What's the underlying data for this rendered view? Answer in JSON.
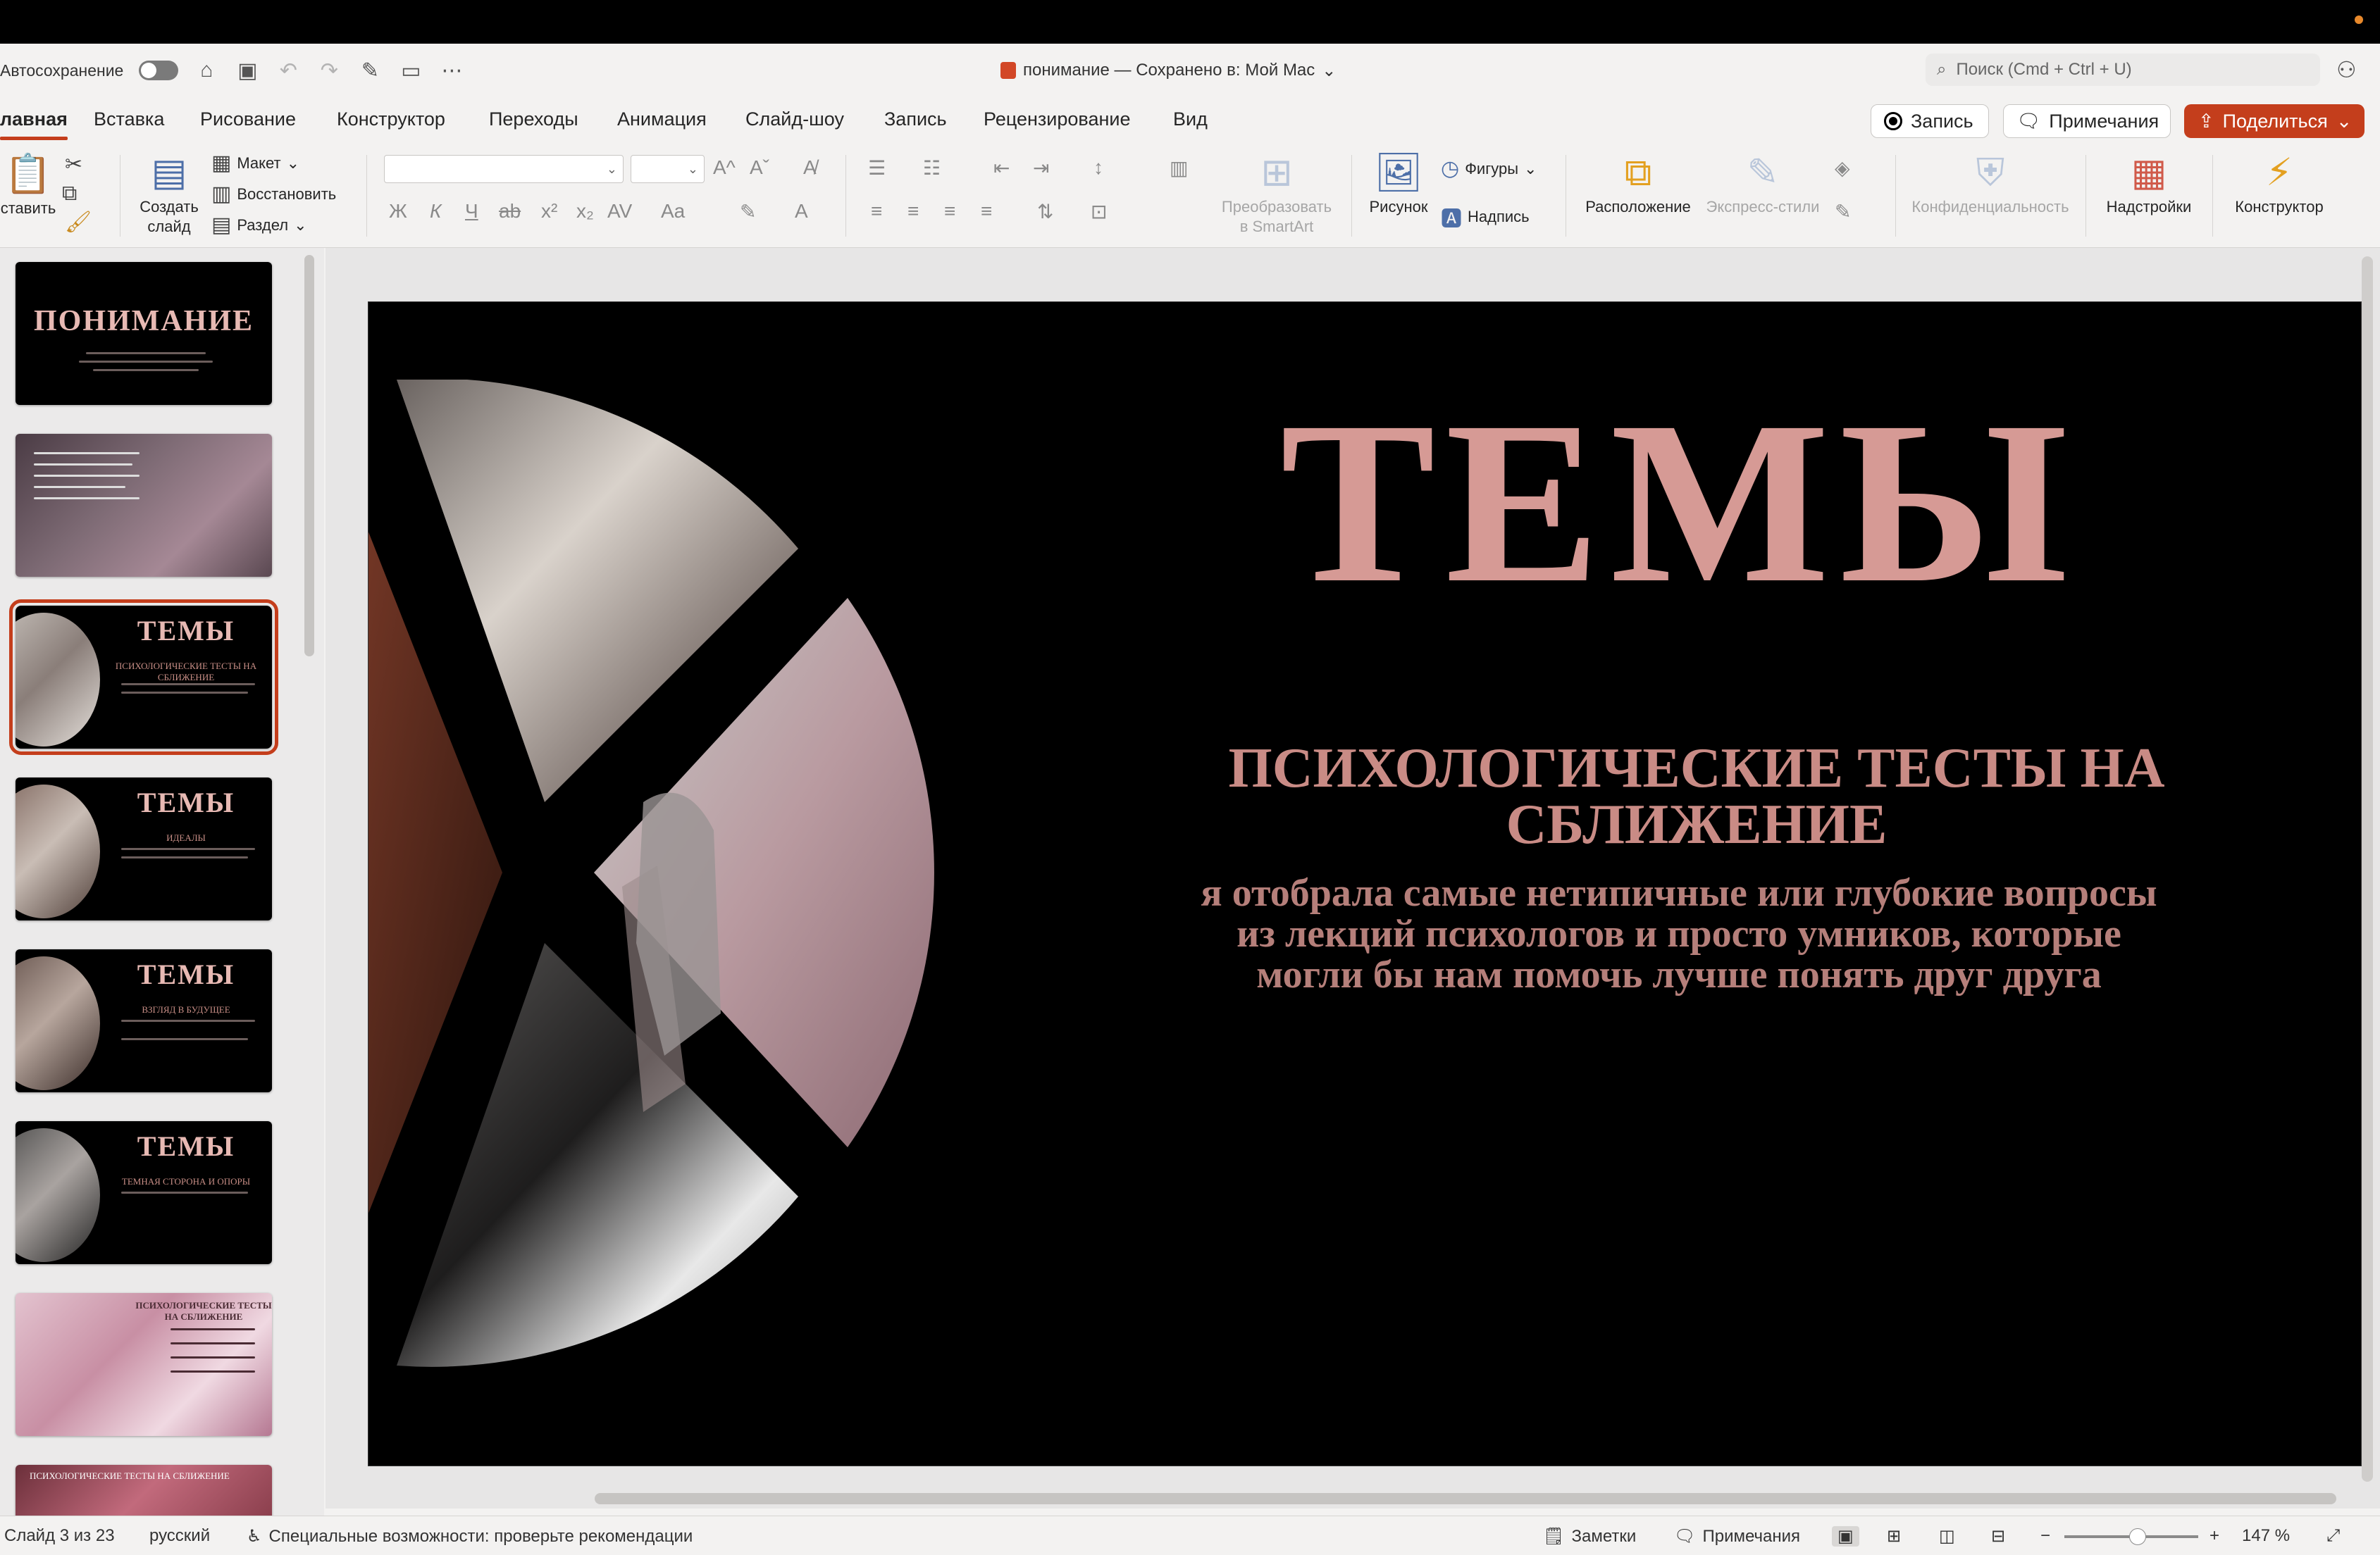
{
  "window": {
    "autosave_label": "Автосохранение",
    "doc_title": "понимание — Сохранено в: Мой Mac",
    "search_placeholder": "Поиск (Cmd + Ctrl + U)"
  },
  "tabs": [
    {
      "label": "лавная",
      "active": true
    },
    {
      "label": "Вставка"
    },
    {
      "label": "Рисование"
    },
    {
      "label": "Конструктор"
    },
    {
      "label": "Переходы"
    },
    {
      "label": "Анимация"
    },
    {
      "label": "Слайд-шоу"
    },
    {
      "label": "Запись"
    },
    {
      "label": "Рецензирование"
    },
    {
      "label": "Вид"
    }
  ],
  "actions": {
    "record": "Запись",
    "comments": "Примечания",
    "share": "Поделиться"
  },
  "ribbon": {
    "paste": "ставить",
    "new_slide_line1": "Создать",
    "new_slide_line2": "слайд",
    "layout": "Макет",
    "reset": "Восстановить",
    "section": "Раздел",
    "bold": "Ж",
    "italic": "К",
    "underline": "Ч",
    "strike": "ab",
    "superscript": "x²",
    "subscript": "x₂",
    "spacing": "AV",
    "case": "Aa",
    "smartart_line1": "Преобразовать",
    "smartart_line2": "в SmartArt",
    "picture": "Рисунок",
    "shapes": "Фигуры",
    "textbox": "Надпись",
    "arrange": "Расположение",
    "quick_styles": "Экспресс-стили",
    "privacy": "Конфиденциальность",
    "addins": "Надстройки",
    "designer": "Конструктор"
  },
  "thumbnails": [
    {
      "title": "ПОНИМАНИЕ"
    },
    {
      "title": ""
    },
    {
      "title": "ТЕМЫ",
      "subtitle": "ПСИХОЛОГИЧЕСКИЕ ТЕСТЫ НА СБЛИЖЕНИЕ",
      "selected": true
    },
    {
      "title": "ТЕМЫ",
      "subtitle": "ИДЕАЛЫ"
    },
    {
      "title": "ТЕМЫ",
      "subtitle": "ВЗГЛЯД В БУДУЩЕЕ"
    },
    {
      "title": "ТЕМЫ",
      "subtitle": "ТЕМНАЯ СТОРОНА И ОПОРЫ"
    },
    {
      "title": "ПСИХОЛОГИЧЕСКИЕ ТЕСТЫ НА СБЛИЖЕНИЕ"
    },
    {
      "title": "ПСИХОЛОГИЧЕСКИЕ ТЕСТЫ НА СБЛИЖЕНИЕ"
    }
  ],
  "slide": {
    "title": "ТЕМЫ",
    "subtitle_line1": "ПСИХОЛОГИЧЕСКИЕ ТЕСТЫ НА",
    "subtitle_line2": "СБЛИЖЕНИЕ",
    "body_line1": "я отобрала самые нетипичные или глубокие вопросы",
    "body_line2": "из лекций психологов и просто умников, которые",
    "body_line3": "могли бы нам помочь лучше понять друг друга"
  },
  "status": {
    "slide_counter": "Слайд 3 из 23",
    "language": "русский",
    "accessibility": "Специальные возможности: проверьте рекомендации",
    "notes": "Заметки",
    "comments": "Примечания",
    "zoom": "147 %"
  },
  "colors": {
    "accent": "#c43e1c",
    "slide_title": "#d69a95",
    "slide_text": "#c98b85"
  }
}
